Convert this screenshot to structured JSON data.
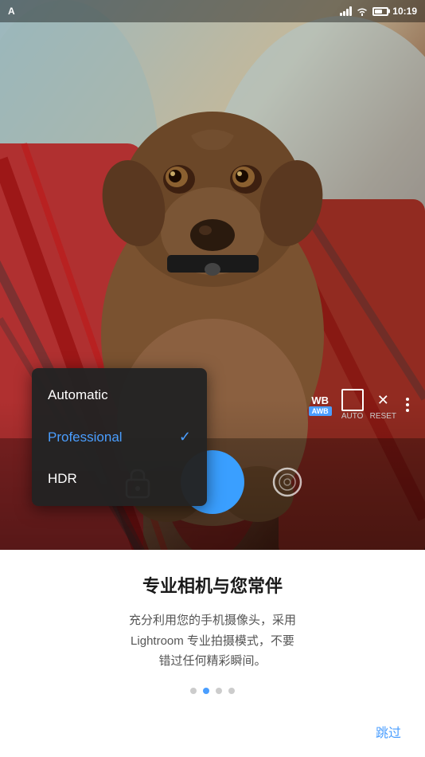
{
  "status_bar": {
    "left_icon": "A",
    "time": "10:19"
  },
  "camera_controls": {
    "wb_label": "WB",
    "awb_label": "AWB",
    "auto_label": "AUTO",
    "reset_label": "RESET"
  },
  "dropdown": {
    "items": [
      {
        "id": "automatic",
        "label": "Automatic",
        "active": false
      },
      {
        "id": "professional",
        "label": "Professional",
        "active": true
      },
      {
        "id": "hdr",
        "label": "HDR",
        "active": false
      }
    ]
  },
  "bottom": {
    "title": "专业相机与您常伴",
    "description": "充分利用您的手机摄像头，采用\nLightroom 专业拍摄模式，不要\n错过任何精彩瞬间。",
    "skip_label": "跳过"
  },
  "dots": {
    "count": 4,
    "active_index": 1
  }
}
